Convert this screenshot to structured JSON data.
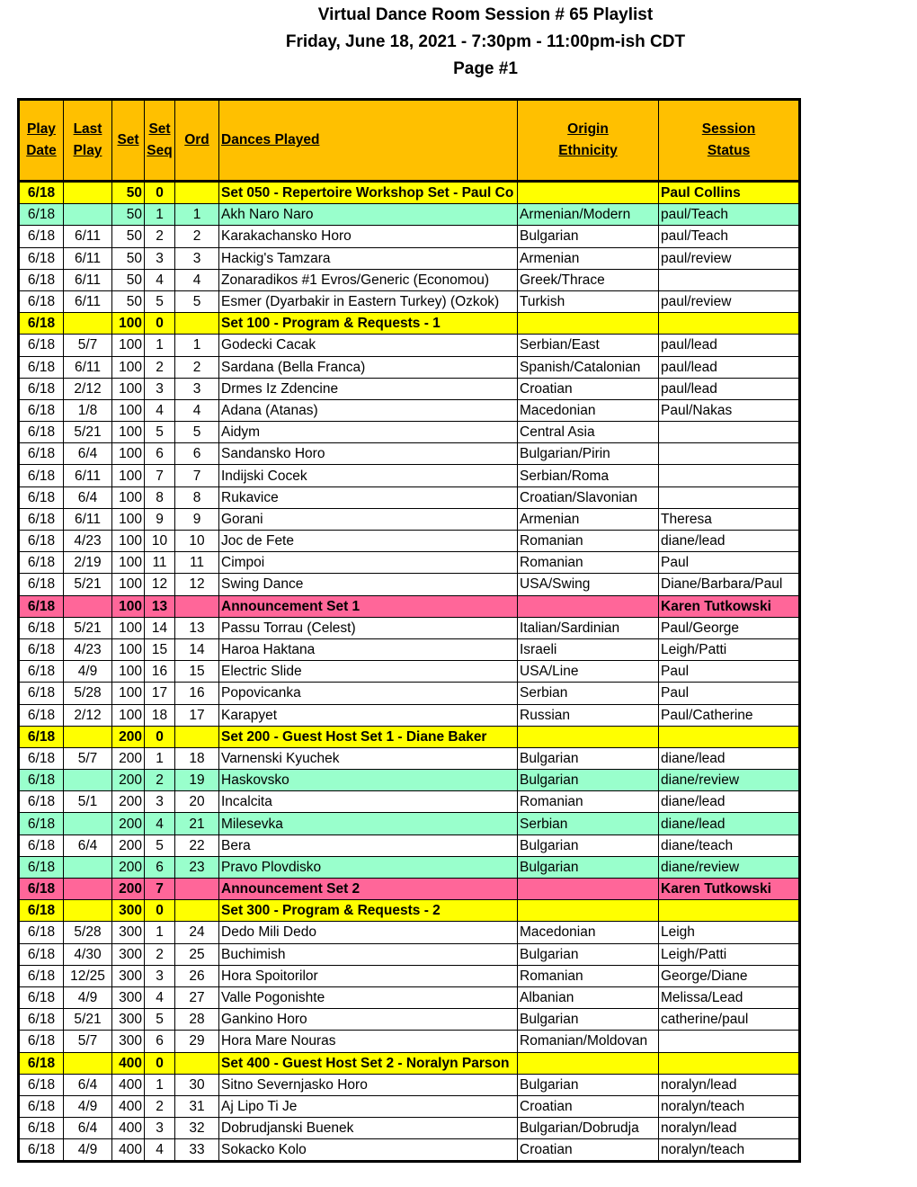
{
  "header": {
    "title": "Virtual Dance Room Session # 65 Playlist",
    "subtitle": "Friday, June 18, 2021 - 7:30pm - 11:00pm-ish CDT",
    "page": "Page #1"
  },
  "colors": {
    "header_bg": "#ffc000",
    "set_row": "#ffff00",
    "announcement_row": "#ff6699",
    "new_dance_row": "#99ffcc"
  },
  "columns": [
    {
      "line1": "Play",
      "line2": "Date"
    },
    {
      "line1": "Last",
      "line2": "Play"
    },
    {
      "line1": "Set",
      "line2": ""
    },
    {
      "line1": "Set",
      "line2": "Seq"
    },
    {
      "line1": "Ord",
      "line2": ""
    },
    {
      "line1": "Dances Played",
      "line2": ""
    },
    {
      "line1": "Origin",
      "line2": "Ethnicity"
    },
    {
      "line1": "Session",
      "line2": "Status"
    }
  ],
  "rows": [
    {
      "type": "set",
      "play": "6/18",
      "last": "",
      "set": "50",
      "seq": "0",
      "ord": "",
      "dance": "Set 050 - Repertoire Workshop Set - Paul Co",
      "origin": "",
      "status": "Paul Collins"
    },
    {
      "type": "new",
      "play": "6/18",
      "last": "",
      "set": "50",
      "seq": "1",
      "ord": "1",
      "dance": "Akh Naro Naro",
      "origin": "Armenian/Modern",
      "status": "paul/Teach"
    },
    {
      "type": "plain",
      "play": "6/18",
      "last": "6/11",
      "set": "50",
      "seq": "2",
      "ord": "2",
      "dance": "Karakachansko Horo",
      "origin": "Bulgarian",
      "status": "paul/Teach"
    },
    {
      "type": "plain",
      "play": "6/18",
      "last": "6/11",
      "set": "50",
      "seq": "3",
      "ord": "3",
      "dance": "Hackig's Tamzara",
      "origin": "Armenian",
      "status": "paul/review"
    },
    {
      "type": "plain",
      "play": "6/18",
      "last": "6/11",
      "set": "50",
      "seq": "4",
      "ord": "4",
      "dance": "Zonaradikos #1 Evros/Generic (Economou)",
      "origin": "Greek/Thrace",
      "status": ""
    },
    {
      "type": "plain",
      "play": "6/18",
      "last": "6/11",
      "set": "50",
      "seq": "5",
      "ord": "5",
      "dance": "Esmer (Dyarbakir in Eastern Turkey) (Ozkok)",
      "origin": "Turkish",
      "status": "paul/review"
    },
    {
      "type": "set",
      "play": "6/18",
      "last": "",
      "set": "100",
      "seq": "0",
      "ord": "",
      "dance": "Set 100 - Program & Requests - 1",
      "origin": "",
      "status": ""
    },
    {
      "type": "plain",
      "play": "6/18",
      "last": "5/7",
      "set": "100",
      "seq": "1",
      "ord": "1",
      "dance": "Godecki Cacak",
      "origin": "Serbian/East",
      "status": "paul/lead"
    },
    {
      "type": "plain",
      "play": "6/18",
      "last": "6/11",
      "set": "100",
      "seq": "2",
      "ord": "2",
      "dance": "Sardana (Bella Franca)",
      "origin": "Spanish/Catalonian",
      "status": "paul/lead"
    },
    {
      "type": "plain",
      "play": "6/18",
      "last": "2/12",
      "set": "100",
      "seq": "3",
      "ord": "3",
      "dance": "Drmes Iz Zdencine",
      "origin": "Croatian",
      "status": "paul/lead"
    },
    {
      "type": "plain",
      "play": "6/18",
      "last": "1/8",
      "set": "100",
      "seq": "4",
      "ord": "4",
      "dance": "Adana (Atanas)",
      "origin": "Macedonian",
      "status": "Paul/Nakas"
    },
    {
      "type": "plain",
      "play": "6/18",
      "last": "5/21",
      "set": "100",
      "seq": "5",
      "ord": "5",
      "dance": "Aidym",
      "origin": "Central Asia",
      "status": ""
    },
    {
      "type": "plain",
      "play": "6/18",
      "last": "6/4",
      "set": "100",
      "seq": "6",
      "ord": "6",
      "dance": "Sandansko Horo",
      "origin": "Bulgarian/Pirin",
      "status": ""
    },
    {
      "type": "plain",
      "play": "6/18",
      "last": "6/11",
      "set": "100",
      "seq": "7",
      "ord": "7",
      "dance": "Indijski Cocek",
      "origin": "Serbian/Roma",
      "status": ""
    },
    {
      "type": "plain",
      "play": "6/18",
      "last": "6/4",
      "set": "100",
      "seq": "8",
      "ord": "8",
      "dance": "Rukavice",
      "origin": "Croatian/Slavonian",
      "status": ""
    },
    {
      "type": "plain",
      "play": "6/18",
      "last": "6/11",
      "set": "100",
      "seq": "9",
      "ord": "9",
      "dance": "Gorani",
      "origin": "Armenian",
      "status": "Theresa"
    },
    {
      "type": "plain",
      "play": "6/18",
      "last": "4/23",
      "set": "100",
      "seq": "10",
      "ord": "10",
      "dance": "Joc de Fete",
      "origin": "Romanian",
      "status": "diane/lead"
    },
    {
      "type": "plain",
      "play": "6/18",
      "last": "2/19",
      "set": "100",
      "seq": "11",
      "ord": "11",
      "dance": "Cimpoi",
      "origin": "Romanian",
      "status": "Paul"
    },
    {
      "type": "plain",
      "play": "6/18",
      "last": "5/21",
      "set": "100",
      "seq": "12",
      "ord": "12",
      "dance": "Swing Dance",
      "origin": "USA/Swing",
      "status": "Diane/Barbara/Paul"
    },
    {
      "type": "ann",
      "play": "6/18",
      "last": "",
      "set": "100",
      "seq": "13",
      "ord": "",
      "dance": "Announcement Set 1",
      "origin": "",
      "status": "Karen Tutkowski"
    },
    {
      "type": "plain",
      "play": "6/18",
      "last": "5/21",
      "set": "100",
      "seq": "14",
      "ord": "13",
      "dance": "Passu Torrau (Celest)",
      "origin": "Italian/Sardinian",
      "status": "Paul/George"
    },
    {
      "type": "plain",
      "play": "6/18",
      "last": "4/23",
      "set": "100",
      "seq": "15",
      "ord": "14",
      "dance": "Haroa Haktana",
      "origin": "Israeli",
      "status": "Leigh/Patti"
    },
    {
      "type": "plain",
      "play": "6/18",
      "last": "4/9",
      "set": "100",
      "seq": "16",
      "ord": "15",
      "dance": "Electric Slide",
      "origin": "USA/Line",
      "status": "Paul"
    },
    {
      "type": "plain",
      "play": "6/18",
      "last": "5/28",
      "set": "100",
      "seq": "17",
      "ord": "16",
      "dance": "Popovicanka",
      "origin": "Serbian",
      "status": "Paul"
    },
    {
      "type": "plain",
      "play": "6/18",
      "last": "2/12",
      "set": "100",
      "seq": "18",
      "ord": "17",
      "dance": "Karapyet",
      "origin": "Russian",
      "status": "Paul/Catherine"
    },
    {
      "type": "set",
      "play": "6/18",
      "last": "",
      "set": "200",
      "seq": "0",
      "ord": "",
      "dance": "Set 200 - Guest Host Set 1 - Diane Baker",
      "origin": "",
      "status": ""
    },
    {
      "type": "plain",
      "play": "6/18",
      "last": "5/7",
      "set": "200",
      "seq": "1",
      "ord": "18",
      "dance": "Varnenski Kyuchek",
      "origin": "Bulgarian",
      "status": "diane/lead"
    },
    {
      "type": "new",
      "play": "6/18",
      "last": "",
      "set": "200",
      "seq": "2",
      "ord": "19",
      "dance": "Haskovsko",
      "origin": "Bulgarian",
      "status": "diane/review"
    },
    {
      "type": "plain",
      "play": "6/18",
      "last": "5/1",
      "set": "200",
      "seq": "3",
      "ord": "20",
      "dance": "Incalcita",
      "origin": "Romanian",
      "status": "diane/lead"
    },
    {
      "type": "new",
      "play": "6/18",
      "last": "",
      "set": "200",
      "seq": "4",
      "ord": "21",
      "dance": "Milesevka",
      "origin": "Serbian",
      "status": "diane/lead"
    },
    {
      "type": "plain",
      "play": "6/18",
      "last": "6/4",
      "set": "200",
      "seq": "5",
      "ord": "22",
      "dance": "Bera",
      "origin": "Bulgarian",
      "status": "diane/teach"
    },
    {
      "type": "new",
      "play": "6/18",
      "last": "",
      "set": "200",
      "seq": "6",
      "ord": "23",
      "dance": "Pravo Plovdisko",
      "origin": "Bulgarian",
      "status": "diane/review"
    },
    {
      "type": "ann",
      "play": "6/18",
      "last": "",
      "set": "200",
      "seq": "7",
      "ord": "",
      "dance": "Announcement Set 2",
      "origin": "",
      "status": "Karen Tutkowski"
    },
    {
      "type": "set",
      "play": "6/18",
      "last": "",
      "set": "300",
      "seq": "0",
      "ord": "",
      "dance": "Set 300 - Program & Requests - 2",
      "origin": "",
      "status": ""
    },
    {
      "type": "plain",
      "play": "6/18",
      "last": "5/28",
      "set": "300",
      "seq": "1",
      "ord": "24",
      "dance": "Dedo Mili Dedo",
      "origin": "Macedonian",
      "status": "Leigh"
    },
    {
      "type": "plain",
      "play": "6/18",
      "last": "4/30",
      "set": "300",
      "seq": "2",
      "ord": "25",
      "dance": "Buchimish",
      "origin": "Bulgarian",
      "status": "Leigh/Patti"
    },
    {
      "type": "plain",
      "play": "6/18",
      "last": "12/25",
      "set": "300",
      "seq": "3",
      "ord": "26",
      "dance": "Hora Spoitorilor",
      "origin": "Romanian",
      "status": "George/Diane"
    },
    {
      "type": "plain",
      "play": "6/18",
      "last": "4/9",
      "set": "300",
      "seq": "4",
      "ord": "27",
      "dance": "Valle Pogonishte",
      "origin": "Albanian",
      "status": "Melissa/Lead"
    },
    {
      "type": "plain",
      "play": "6/18",
      "last": "5/21",
      "set": "300",
      "seq": "5",
      "ord": "28",
      "dance": "Gankino Horo",
      "origin": "Bulgarian",
      "status": "catherine/paul"
    },
    {
      "type": "plain",
      "play": "6/18",
      "last": "5/7",
      "set": "300",
      "seq": "6",
      "ord": "29",
      "dance": "Hora Mare Nouras",
      "origin": "Romanian/Moldovan",
      "status": ""
    },
    {
      "type": "set",
      "play": "6/18",
      "last": "",
      "set": "400",
      "seq": "0",
      "ord": "",
      "dance": "Set 400 - Guest Host Set 2 - Noralyn Parson",
      "origin": "",
      "status": ""
    },
    {
      "type": "plain",
      "play": "6/18",
      "last": "6/4",
      "set": "400",
      "seq": "1",
      "ord": "30",
      "dance": "Sitno Severnjasko Horo",
      "origin": "Bulgarian",
      "status": "noralyn/lead"
    },
    {
      "type": "plain",
      "play": "6/18",
      "last": "4/9",
      "set": "400",
      "seq": "2",
      "ord": "31",
      "dance": "Aj Lipo Ti Je",
      "origin": "Croatian",
      "status": "noralyn/teach"
    },
    {
      "type": "plain",
      "play": "6/18",
      "last": "6/4",
      "set": "400",
      "seq": "3",
      "ord": "32",
      "dance": "Dobrudjanski Buenek",
      "origin": "Bulgarian/Dobrudja",
      "status": "noralyn/lead"
    },
    {
      "type": "plain",
      "play": "6/18",
      "last": "4/9",
      "set": "400",
      "seq": "4",
      "ord": "33",
      "dance": "Sokacko Kolo",
      "origin": "Croatian",
      "status": "noralyn/teach"
    }
  ]
}
